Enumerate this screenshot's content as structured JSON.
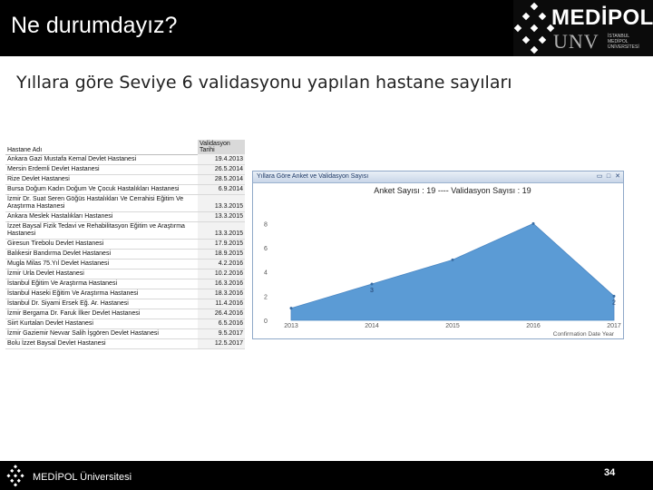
{
  "header": {
    "title": "Ne durumdayız?",
    "logo_text": "MEDİPOL",
    "logo_sub": "UNV",
    "logo_small": "İSTANBUL MEDİPOL ÜNİVERSİTESİ",
    "logo_icon": "x-pattern-logo-icon"
  },
  "subtitle": "Yıllara göre Seviye 6 validasyonu yapılan hastane sayıları",
  "table": {
    "headers": {
      "name": "Hastane Adı",
      "date": "Validasyon Tarihi"
    },
    "rows": [
      {
        "name": "Ankara Gazi Mustafa Kemal Devlet Hastanesi",
        "date": "19.4.2013"
      },
      {
        "name": "Mersin Erdemli Devlet Hastanesi",
        "date": "26.5.2014"
      },
      {
        "name": "Rize Devlet Hastanesi",
        "date": "28.5.2014"
      },
      {
        "name": "Bursa Doğum Kadın Doğum Ve Çocuk Hastalıkları Hastanesi",
        "date": "6.9.2014"
      },
      {
        "name": "İzmir Dr. Suat Seren Göğüs Hastalıkları Ve Cerrahisi Eğitim Ve Araştırma Hastanesi",
        "date": "13.3.2015"
      },
      {
        "name": "Ankara Meslek Hastalıkları Hastanesi",
        "date": "13.3.2015"
      },
      {
        "name": "İzzet Baysal Fizik Tedavi ve Rehabilitasyon Eğitim ve Araştırma Hastanesi",
        "date": "13.3.2015"
      },
      {
        "name": "Giresun Tirebolu Devlet Hastanesi",
        "date": "17.9.2015"
      },
      {
        "name": "Balıkesir Bandırma Devlet Hastanesi",
        "date": "18.9.2015"
      },
      {
        "name": "Mugla Milas 75.Yıl Devlet Hastanesi",
        "date": "4.2.2016"
      },
      {
        "name": "İzmir Urla Devlet Hastanesi",
        "date": "10.2.2016"
      },
      {
        "name": "İstanbul Eğitim Ve Araştırma Hastanesi",
        "date": "16.3.2016"
      },
      {
        "name": "İstanbul Haseki Eğitim Ve Araştırma Hastanesi",
        "date": "18.3.2016"
      },
      {
        "name": "İstanbul Dr. Siyami Ersek Eğ. Ar. Hastanesi",
        "date": "11.4.2016"
      },
      {
        "name": "İzmir Bergama Dr. Faruk İlker Devlet Hastanesi",
        "date": "26.4.2016"
      },
      {
        "name": "Siirt Kurtalan Devlet Hastanesi",
        "date": "6.5.2016"
      },
      {
        "name": "İzmir Gaziemir Nevvar Salih İşgören Devlet Hastanesi",
        "date": "9.5.2017"
      },
      {
        "name": "Bolu İzzet Baysal Devlet Hastanesi",
        "date": "12.5.2017"
      }
    ]
  },
  "chart_window": {
    "title": "Yıllara Göre Anket ve Validasyon Sayısı",
    "controls": [
      "restore-icon",
      "maximize-icon",
      "close-icon"
    ]
  },
  "chart_data": {
    "type": "area",
    "title": "Anket Sayısı : 19 ---- Validasyon Sayısı : 19",
    "categories": [
      "2013",
      "2014",
      "2015",
      "2016",
      "2017"
    ],
    "series": [
      {
        "name": "Anket Sayısı",
        "values": [
          1,
          3,
          5,
          8,
          2
        ]
      }
    ],
    "data_labels": [
      "",
      "3",
      "",
      "",
      "2"
    ],
    "xlabel": "Confirmation Date Year",
    "ylabel": "",
    "yticks": [
      0,
      2,
      4,
      6,
      8
    ],
    "ylim": [
      0,
      9
    ],
    "grid": false,
    "fill_color": "#5b9bd5",
    "legend_position": "top-center"
  },
  "footer": {
    "text": "MEDİPOL Üniversitesi",
    "page_number": "34",
    "logo_icon": "x-pattern-logo-icon"
  }
}
